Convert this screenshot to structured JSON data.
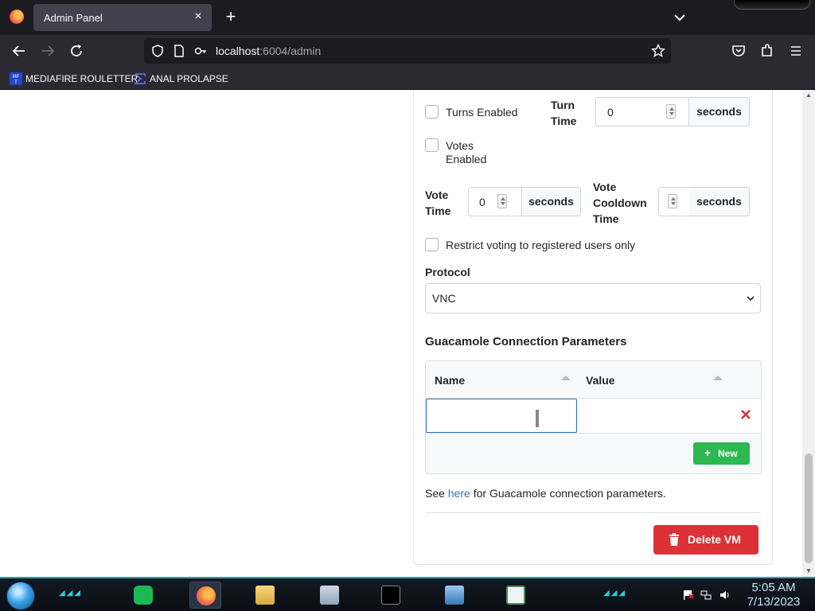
{
  "browser": {
    "tab_title": "Admin Panel",
    "url_host": "localhost",
    "url_path": ":6004/admin",
    "bookmarks": [
      {
        "label": "MEDIAFIRE ROULETTER",
        "icon": "mft-favicon"
      },
      {
        "label": "ANAL PROLAPSE",
        "icon": "sigma-favicon"
      }
    ]
  },
  "form": {
    "turns_enabled_label": "Turns Enabled",
    "turn_time_label": "Turn Time",
    "turn_time_value": "0",
    "seconds_label": "seconds",
    "votes_enabled_label": "Votes Enabled",
    "vote_time_label": "Vote Time",
    "vote_time_value": "0",
    "vote_cooldown_label": "Vote Cooldown Time",
    "vote_cooldown_value": "",
    "restrict_voting_label": "Restrict voting to registered users only",
    "protocol_label": "Protocol",
    "protocol_value": "VNC"
  },
  "guac": {
    "title": "Guacamole Connection Parameters",
    "columns": [
      "Name",
      "Value"
    ],
    "rows": [
      {
        "name": "",
        "value": ""
      }
    ],
    "new_button": "New",
    "note_prefix": "See ",
    "note_link": "here",
    "note_suffix": " for Guacamole connection parameters."
  },
  "delete_vm_button": "Delete VM",
  "taskbar": {
    "time": "5:05 AM",
    "date": "7/13/2023"
  },
  "colors": {
    "accent_blue": "#3273b8",
    "success_green": "#2db851",
    "danger_red": "#dc3237"
  }
}
